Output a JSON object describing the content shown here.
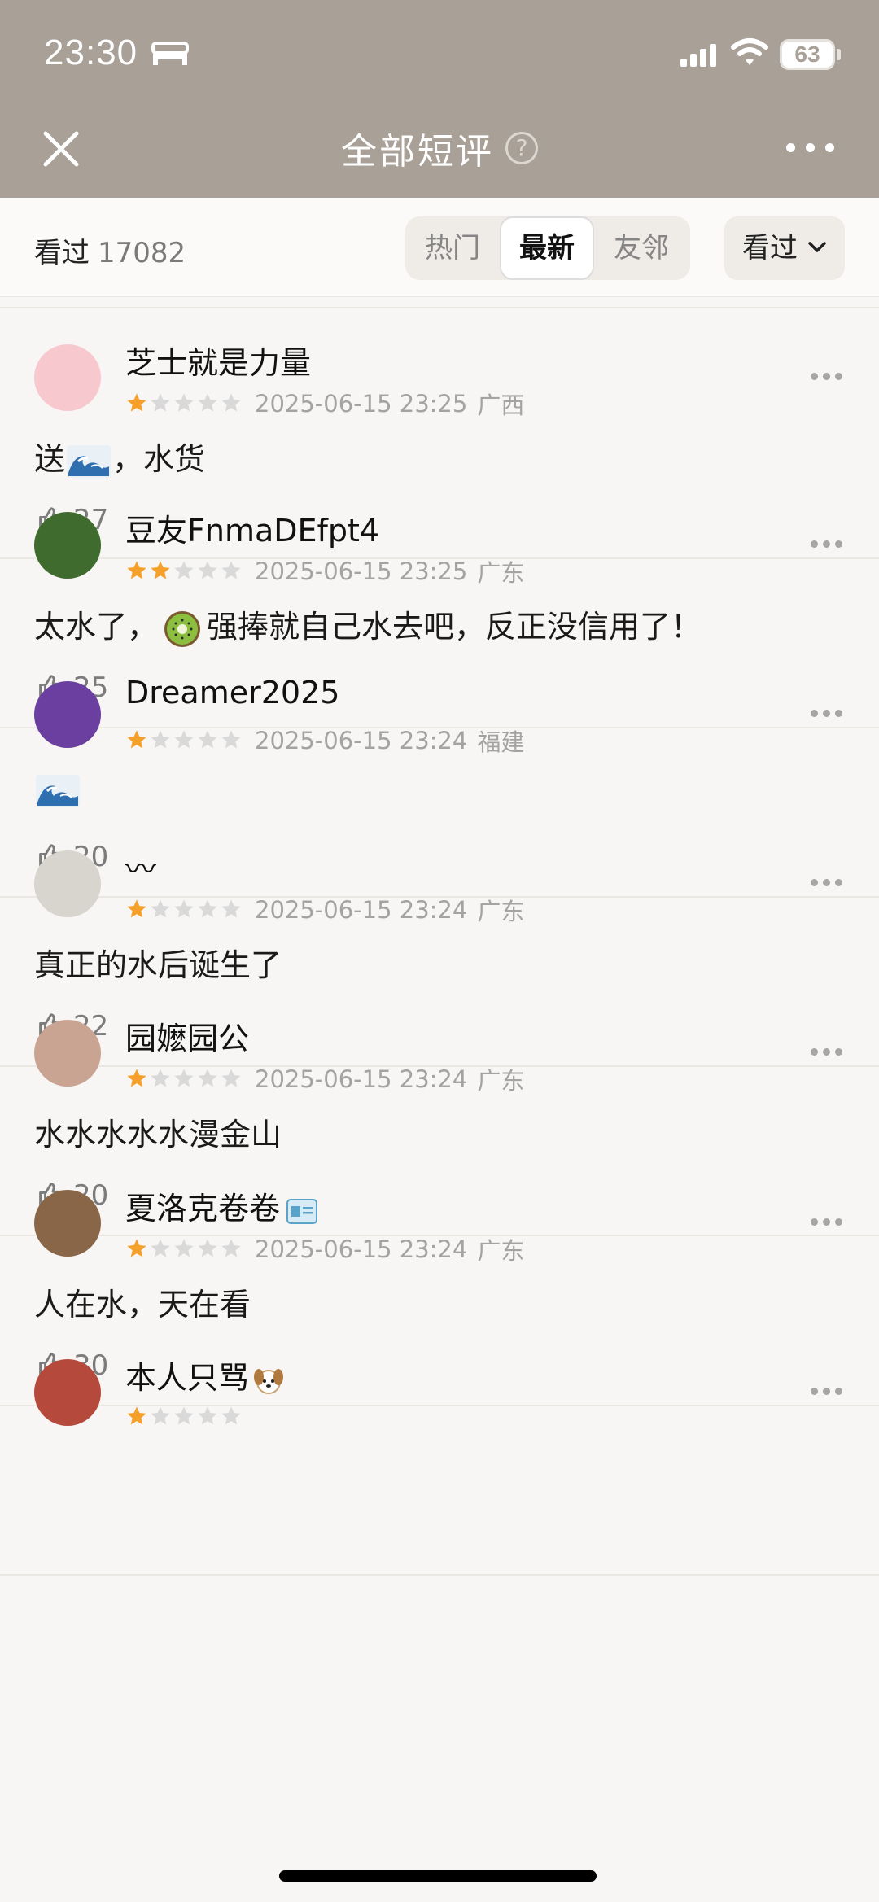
{
  "status_bar": {
    "time": "23:30",
    "battery": "63"
  },
  "nav": {
    "title": "全部短评",
    "help": "?"
  },
  "filter": {
    "seen_label": "看过",
    "seen_count": "17082",
    "tabs": [
      {
        "label": "热门"
      },
      {
        "label": "最新",
        "active": true
      },
      {
        "label": "友邻"
      }
    ],
    "dropdown": "看过"
  },
  "reviews": [
    {
      "name": "芝士就是力量",
      "rating": 1,
      "datetime": "2025-06-15 23:25",
      "location": "广西",
      "text_a": "送",
      "text_b": "，水货",
      "likes": "27",
      "avatar_color": "#f7c9cf"
    },
    {
      "name": "豆友FnmaDEfpt4",
      "rating": 2,
      "datetime": "2025-06-15 23:25",
      "location": "广东",
      "text_a": "太水了，",
      "text_b": "强捧就自己水去吧，反正没信用了！",
      "likes": "25",
      "avatar_color": "#3f6b2e"
    },
    {
      "name": "Dreamer2025",
      "rating": 1,
      "datetime": "2025-06-15 23:24",
      "location": "福建",
      "text_a": "",
      "text_b": "",
      "likes": "20",
      "avatar_color": "#6a3fa0"
    },
    {
      "name": "〰",
      "rating": 1,
      "datetime": "2025-06-15 23:24",
      "location": "广东",
      "text_a": "真正的水后诞生了",
      "text_b": "",
      "likes": "22",
      "avatar_color": "#d8d4ce"
    },
    {
      "name": "园嬷园公",
      "rating": 1,
      "datetime": "2025-06-15 23:24",
      "location": "广东",
      "text_a": "水水水水水漫金山",
      "text_b": "",
      "likes": "20",
      "avatar_color": "#c9a493"
    },
    {
      "name": "夏洛克卷卷",
      "rating": 1,
      "datetime": "2025-06-15 23:24",
      "location": "广东",
      "text_a": "人在水，天在看",
      "text_b": "",
      "likes": "30",
      "avatar_color": "#8a6648"
    },
    {
      "name": "本人只骂",
      "rating": 1,
      "datetime": "",
      "location": "",
      "text_a": "",
      "text_b": "",
      "likes": "",
      "avatar_color": "#b54a3c"
    }
  ],
  "colors": {
    "nav_bg": "#a9a097",
    "page_bg": "#f8f6f4",
    "star_on": "#f4a02a",
    "star_off": "#d9d9d9"
  }
}
